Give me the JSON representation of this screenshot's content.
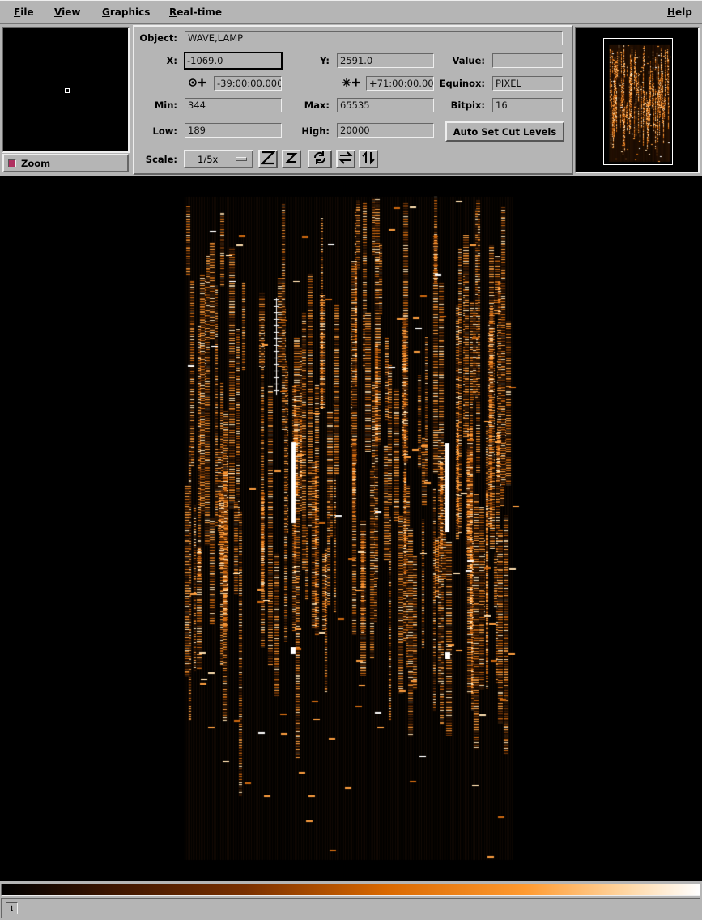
{
  "menu": {
    "file": "File",
    "view": "View",
    "graphics": "Graphics",
    "realtime": "Real-time",
    "help": "Help"
  },
  "zoom_panel": {
    "toggle_label": "Zoom"
  },
  "info": {
    "object_label": "Object:",
    "object_value": "WAVE,LAMP",
    "x_label": "X:",
    "x_value": "-1069.0",
    "y_label": "Y:",
    "y_value": "2591.0",
    "value_label": "Value:",
    "value_value": "",
    "ra_icon": "ra-axis-icon",
    "ra_value": "-39:00:00.000",
    "dec_icon": "dec-axis-icon",
    "dec_value": "+71:00:00.00",
    "equinox_label": "Equinox:",
    "equinox_value": "PIXEL",
    "min_label": "Min:",
    "min_value": "344",
    "max_label": "Max:",
    "max_value": "65535",
    "bitpix_label": "Bitpix:",
    "bitpix_value": "16",
    "low_label": "Low:",
    "low_value": "189",
    "high_label": "High:",
    "high_value": "20000",
    "auto_cut_label": "Auto Set Cut Levels",
    "scale_label": "Scale:",
    "scale_value": "1/5x"
  },
  "toolbar_icons": [
    "zoom-in-icon",
    "zoom-out-icon",
    "rotate-icon",
    "flip-x-icon",
    "flip-y-icon"
  ],
  "colors": {
    "background": "#b5b5b5",
    "canvas": "#000000",
    "spectrum_bright": "#ffffff",
    "spectrum_mid": "#ff9a30",
    "spectrum_dim": "#7a3000"
  },
  "status": {
    "icon": "info-icon"
  }
}
